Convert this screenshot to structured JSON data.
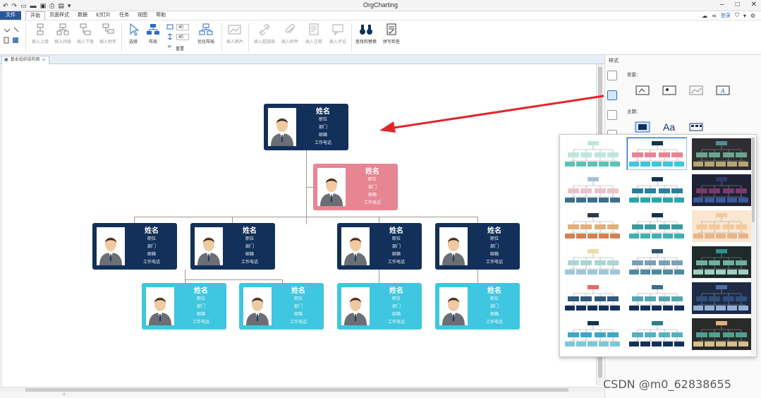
{
  "window": {
    "title": "OrgCharting"
  },
  "menu": {
    "items": [
      "文件",
      "开始",
      "页面样式",
      "数据",
      "幻灯片",
      "任务",
      "视图",
      "帮助"
    ],
    "login": "登录"
  },
  "ribbon": {
    "buttons": [
      "插入上级",
      "插入同级",
      "插入下级",
      "插入助手",
      "选择",
      "布局",
      "优化布局",
      "插入图片",
      "插入超链接",
      "插入附件",
      "插入注释",
      "插入评论",
      "查找和替换",
      "拼写检查"
    ],
    "spin_width": "40",
    "spin_height": "40",
    "reset": "重置"
  },
  "tab": {
    "label": "基本组织结构图",
    "close": "×"
  },
  "org": {
    "name": "姓名",
    "fields": [
      "职位",
      "部门",
      "邮箱",
      "工作电话"
    ],
    "colors": {
      "navy": "#12305a",
      "pink": "#e78593",
      "cyan": "#3fc6e0",
      "arrow": "#e0262b"
    }
  },
  "panel": {
    "title": "样式",
    "background_label": "背景：",
    "theme_label": "主题：",
    "text_icon": "Aa"
  },
  "watermark": "CSDN @m0_62838655"
}
